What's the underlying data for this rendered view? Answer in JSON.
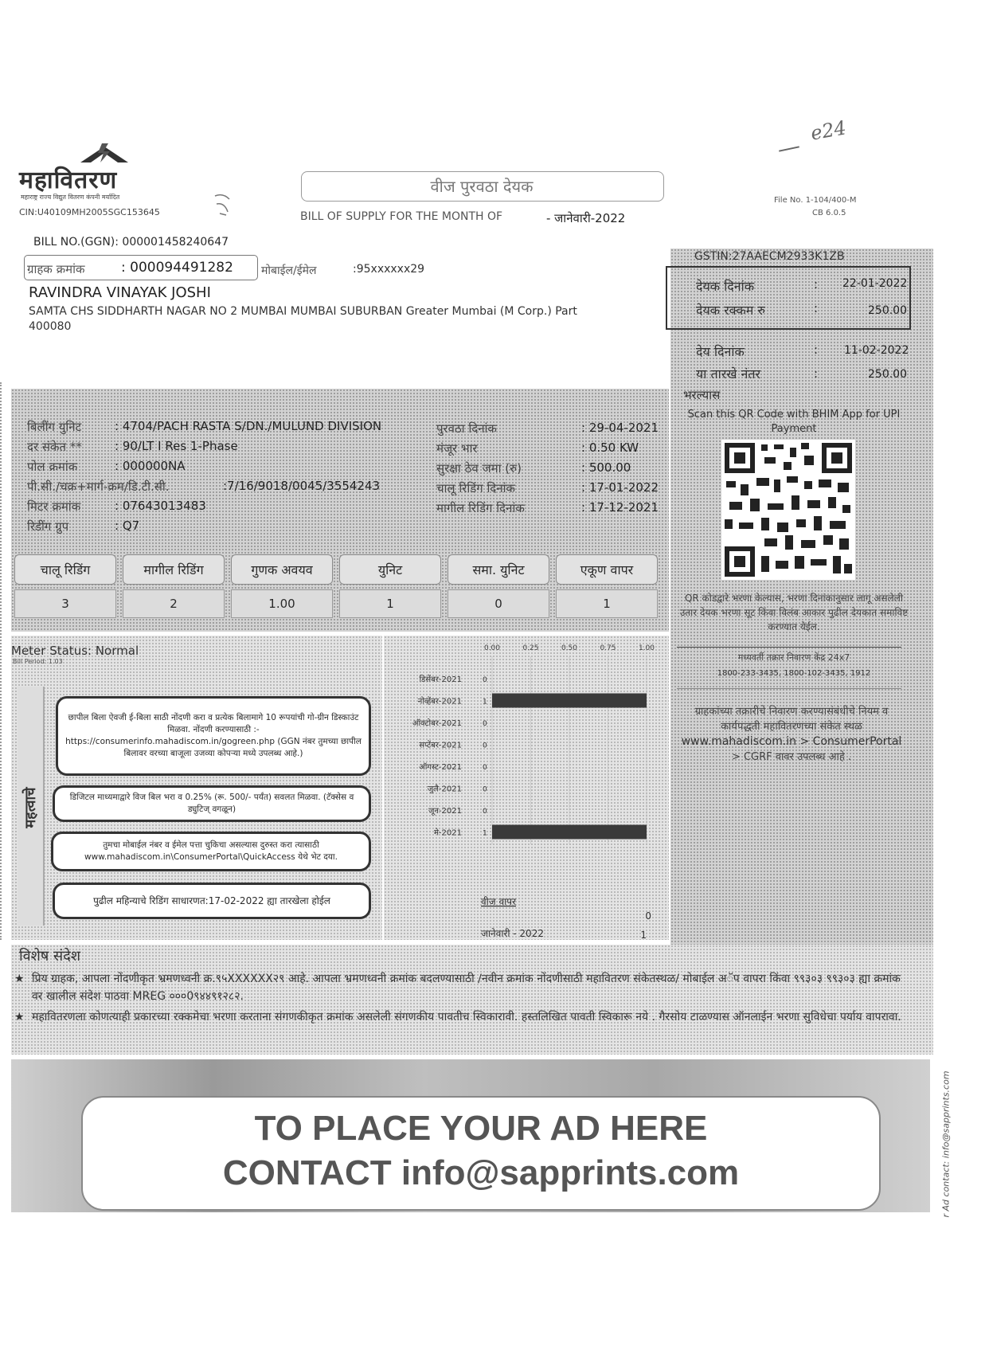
{
  "header": {
    "logo_text": "महावितरण",
    "logo_subtitle": "महाराष्ट्र राज्य विद्युत वितरण कंपनी मर्यादित",
    "cin": "CIN:U40109MH2005SGC153645",
    "doc_title": "वीज पुरवठा देयक",
    "bill_of_supply_label": "BILL OF SUPPLY FOR THE MONTH OF",
    "bill_month": "- जानेवारी-2022",
    "file_no": "File No. 1-104/400-M",
    "cb": "CB 6.0.5",
    "handwritten_mark": "e24"
  },
  "consumer": {
    "bill_no_label": "BILL NO.(GGN):",
    "bill_no": "000001458240647",
    "consumer_no_label": "ग्राहक क्रमांक",
    "consumer_no": ": 000094491282",
    "mobile_label": "मोबाईल/ईमेल",
    "mobile": ":95xxxxxx29",
    "name": "RAVINDRA VINAYAK JOSHI",
    "address_line1": "SAMTA CHS SIDDHARTH NAGAR NO 2 MUMBAI MUMBAI SUBURBAN Greater Mumbai (M Corp.) Part",
    "address_line2": "400080"
  },
  "summary": {
    "gstin": "GSTIN:27AAECM2933K1ZB",
    "bill_date_label": "देयक दिनांक",
    "bill_date": "22-01-2022",
    "bill_amount_label": "देयक रक्कम रु",
    "bill_amount": "250.00",
    "due_date_label": "देय दिनांक",
    "due_date": "11-02-2022",
    "after_label": "या तारखे नंतर",
    "after_amount": "250.00",
    "payment_label": "भरल्यास",
    "qr_caption": "Scan this QR Code with BHIM App for UPI Payment",
    "qr_note": "QR कोडद्वारे भरणा केल्यास, भरणा दिनांकानुसार लागू असलेली उतार देयक भरणा सूट किंवा विलंब आकार पुढील देयकात समाविष्ट करण्यात येईल.",
    "helpline_title": "मध्यवर्ती तक्रार निवारण केंद्र 24x7",
    "helpline_numbers": "1800-233-3435, 1800-102-3435, 1912",
    "grievance_text": "ग्राहकांच्या तक्रारीचे निवारण करण्यासंबंधीचे नियम व कार्यपद्धती महावितरणच्या संकेत स्थळ",
    "grievance_link": "www.mahadiscom.in > ConsumerPortal",
    "grievance_tail": "> CGRF वावर उपलब्ध आहे ."
  },
  "details": {
    "left": [
      {
        "label": "बिलींग युनिट",
        "value": ": 4704/PACH RASTA S/DN./MULUND DIVISION"
      },
      {
        "label": "दर संकेत **",
        "value": ": 90/LT I Res 1-Phase"
      },
      {
        "label": "पोल क्रमांक",
        "value": ": 000000NA"
      },
      {
        "label": "पी.सी./चक्र+मार्ग-क्रम/डि.टी.सी.",
        "value": ":7/16/9018/0045/3554243"
      },
      {
        "label": "मिटर क्रमांक",
        "value": ": 07643013483"
      },
      {
        "label": "रिडींग ग्रुप",
        "value": ": Q7"
      }
    ],
    "right": [
      {
        "label": "पुरवठा दिनांक",
        "value": ": 29-04-2021"
      },
      {
        "label": "मंजूर भार",
        "value": ": 0.50 KW"
      },
      {
        "label": "सुरक्षा ठेव जमा (रु)",
        "value": ": 500.00"
      },
      {
        "label": "चालू रिडिंग दिनांक",
        "value": ": 17-01-2022"
      },
      {
        "label": "मागील रिडिंग दिनांक",
        "value": ": 17-12-2021"
      }
    ]
  },
  "reading_table": {
    "headers": [
      "चालू रिडिंग",
      "मागील रिडिंग",
      "गुणक अवयव",
      "युनिट",
      "समा. युनिट",
      "एकूण वापर"
    ],
    "values": [
      "3",
      "2",
      "1.00",
      "1",
      "0",
      "1"
    ]
  },
  "meter": {
    "status": "Meter Status: Normal",
    "bill_period": "Bill Period: 1.03",
    "side_label": "महत्वाचे"
  },
  "notes": [
    "छापील बिला ऐवजी ई-बिला साठी नोंदणी करा व प्रत्येक बिलामागे 10 रूपयांची गो-ग्रीन डिस्काउंट मिळवा. नोंदणी करण्यासाठी :- https://consumerinfo.mahadiscom.in/gogreen.php (GGN नंबर तुमच्या छापील बिलावर वरच्या बाजूला उजव्या कोपऱ्या मध्ये उपलब्ध आहे.)",
    "डिजिटल माध्यमाद्वारे विज बिल भरा व 0.25% (रू. 500/- पर्यंत) सवलत मिळवा. (टॅक्सेस व ड्युटिज् वगळून)",
    "तुमचा मोबाईल नंबर व ईमेल पत्ता चुकिचा असल्यास दुरुस्त करा त्यासाठी www.mahadiscom.in\\ConsumerPortal\\QuickAccess येथे भेट दया.",
    "पुढील महिन्याचे रिडिंग साधारणत:17-02-2022 ह्या तारखेला होईल"
  ],
  "chart_data": {
    "type": "bar",
    "orientation": "horizontal",
    "categories": [
      "डिसेंबर-2021",
      "नोव्हेंबर-2021",
      "ऑक्टोबर-2021",
      "सप्टेंबर-2021",
      "ऑगस्ट-2021",
      "जुलै-2021",
      "जून-2021",
      "मे-2021"
    ],
    "values": [
      0,
      1,
      0,
      0,
      0,
      0,
      0,
      1
    ],
    "xticks": [
      "0.00",
      "0.25",
      "0.50",
      "0.75",
      "1.00"
    ],
    "xlim": [
      0,
      1
    ],
    "footer_label": "वीज वापर",
    "footer_row1_value": "0",
    "footer_row2_label": "जानेवारी - 2022",
    "footer_row2_value": "1"
  },
  "special_message": {
    "title": "विशेष संदेश",
    "items": [
      "प्रिय ग्राहक, आपला नोंदणीकृत भ्रमणध्वनी क्र.९५XXXXXX२९ आहे. आपला भ्रमणध्वनी क्रमांक बदलण्यासाठी /नवीन क्रमांक नोंदणीसाठी महावितरण संकेतस्थळ/ मोबाईल अॅप वापरा किंवा ९९३०३ ९९३०३ ह्या क्रमांक वर खालील संदेश पाठवा MREG ०००0९४४९१२८२.",
      "महावितरणला कोणत्याही प्रकारच्या रक्कमेचा भरणा करताना संगणकीकृत क्रमांक असलेली संगणकीय पावतीच स्विकारावी. हस्तलिखित पावती स्विकारू नये . गैरसोय टाळण्यास ऑनलाईन भरणा सुविधेचा पर्याय वापरावा."
    ]
  },
  "ad": {
    "line1": "TO PLACE YOUR AD HERE",
    "line2": "CONTACT info@sapprints.com",
    "side_text": "r Ad contact: info@sapprints.com"
  },
  "colors": {
    "shade": "#d2d2d2",
    "ink": "#2a2a2a",
    "bar": "#3a3a3a"
  }
}
